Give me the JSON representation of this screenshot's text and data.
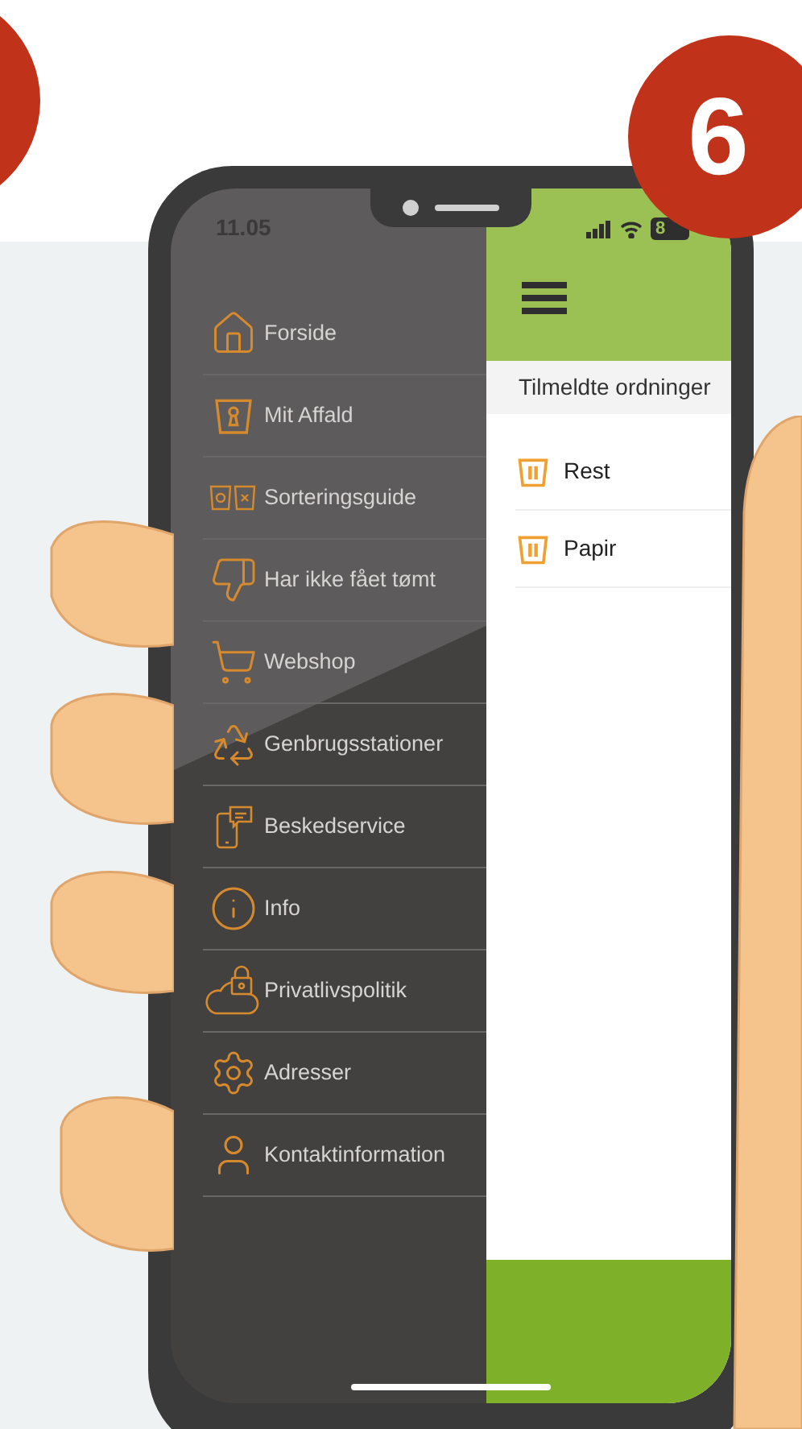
{
  "step_badge": "6",
  "status_bar": {
    "time": "11.05",
    "battery": "8"
  },
  "menu": [
    {
      "label": "Forside",
      "kind": "home"
    },
    {
      "label": "Mit Affald",
      "kind": "bin"
    },
    {
      "label": "Sorteringsguide",
      "kind": "bins"
    },
    {
      "label": "Har ikke fået tømt",
      "kind": "thumbs-down"
    },
    {
      "label": "Webshop",
      "kind": "cart"
    },
    {
      "label": "Genbrugsstationer",
      "kind": "recycle"
    },
    {
      "label": "Beskedservice",
      "kind": "phone-message"
    },
    {
      "label": "Info",
      "kind": "info"
    },
    {
      "label": "Privatlivspolitik",
      "kind": "cloud-lock"
    },
    {
      "label": "Adresser",
      "kind": "gear"
    },
    {
      "label": "Kontaktinformation",
      "kind": "person"
    }
  ],
  "section_title": "Tilmeldte ordninger",
  "schemes": [
    {
      "label": "Rest"
    },
    {
      "label": "Papir"
    }
  ]
}
